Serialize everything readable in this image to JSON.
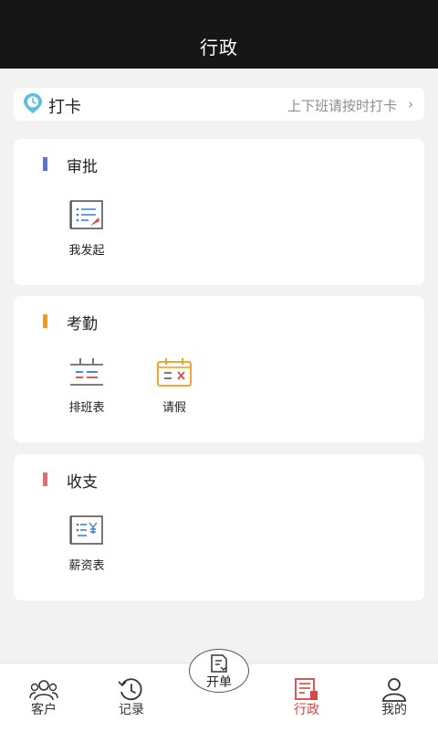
{
  "header": {
    "title": "行政"
  },
  "clock_in": {
    "label": "打卡",
    "hint": "上下班请按时打卡",
    "chevron": "›",
    "icon": "location-clock-icon",
    "icon_color": "#5bc0de"
  },
  "sections": [
    {
      "title": "审批",
      "accent": "#5b73d6",
      "items": [
        {
          "label": "我发起",
          "icon": "approval-list-icon"
        }
      ]
    },
    {
      "title": "考勤",
      "accent": "#f39a1f",
      "items": [
        {
          "label": "排班表",
          "icon": "schedule-icon"
        },
        {
          "label": "请假",
          "icon": "leave-calendar-icon"
        }
      ]
    },
    {
      "title": "收支",
      "accent": "#ee6a64",
      "items": [
        {
          "label": "薪资表",
          "icon": "salary-sheet-icon"
        }
      ]
    }
  ],
  "tabbar": {
    "items": [
      {
        "label": "客户",
        "icon": "customers-icon"
      },
      {
        "label": "记录",
        "icon": "history-icon"
      },
      {
        "label": "行政",
        "icon": "admin-icon",
        "active": true
      },
      {
        "label": "我的",
        "icon": "profile-icon"
      }
    ],
    "center": {
      "label": "开单",
      "icon": "new-order-icon"
    },
    "active_color": "#d94646"
  }
}
